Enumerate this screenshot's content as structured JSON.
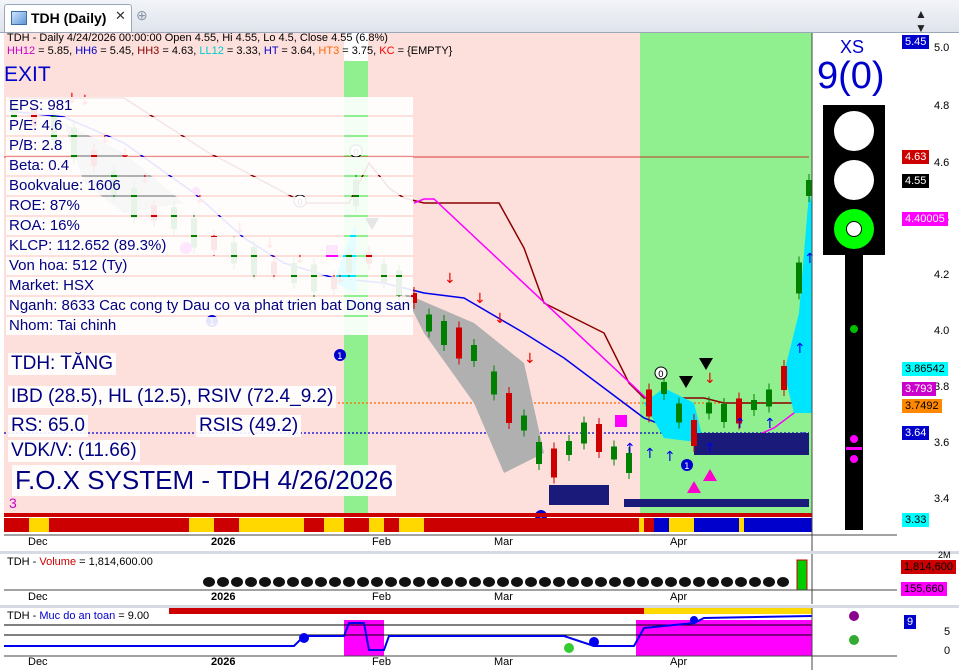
{
  "tab": {
    "title": "TDH (Daily)",
    "close": "✕",
    "add": "⊕"
  },
  "window_controls": "▲ ▼ ▲",
  "main": {
    "info_line1": "TDH - Daily 4/24/2026 00:00:00 Open 4.55, Hi 4.55, Lo 4.5, Close 4.55 (6.8%)",
    "info_line2": [
      {
        "text": "HH12",
        "color": "#cc00cc"
      },
      {
        "text": " = 5.85, ",
        "color": "#000"
      },
      {
        "text": "HH6",
        "color": "#0000cc"
      },
      {
        "text": " = 5.45, ",
        "color": "#000"
      },
      {
        "text": "HH3",
        "color": "#8b0000"
      },
      {
        "text": " = 4.63, ",
        "color": "#000"
      },
      {
        "text": "LL12",
        "color": "#00cccc"
      },
      {
        "text": " = 3.33, ",
        "color": "#000"
      },
      {
        "text": "HT",
        "color": "#0000cc"
      },
      {
        "text": "  = 3.64, ",
        "color": "#000"
      },
      {
        "text": "HT3",
        "color": "#ff6600"
      },
      {
        "text": " = 3.75, ",
        "color": "#000"
      },
      {
        "text": "KC",
        "color": "#ff0000"
      },
      {
        "text": " = {EMPTY}",
        "color": "#000"
      }
    ],
    "exit_label": "EXIT",
    "fundamentals": [
      "EPS: 981",
      "P/E: 4.6",
      "P/B: 2.8",
      "Beta: 0.4",
      "Bookvalue: 1606",
      "ROE: 87%",
      "ROA: 16%",
      "KLCP: 112.652 (89.3%)",
      "Von hoa: 512 (Ty)",
      "Market: HSX",
      "Nganh: 8633 Cac cong ty Dau co va phat trien bat Dong san",
      "Nhom: Tai chinh"
    ],
    "signal_title": "TDH: TĂNG",
    "ibd_line": "IBD (28.5), HL (12.5), RSIV (72.4_9.2)",
    "rs_line": "RS: 65.0",
    "rsis_line": "RSIS (49.2)",
    "vdk_line": "VDK/V:  (11.66)",
    "fox_line": "F.O.X SYSTEM - TDH 4/26/2026",
    "bottom_num": "3",
    "xs_label": "XS",
    "xs_value": "9(0)",
    "y_ticks": [
      "5.0",
      "4.8",
      "4.6",
      "4.4",
      "4.2",
      "4.0",
      "3.8",
      "3.6",
      "3.4"
    ],
    "x_labels": [
      "Dec",
      "2026",
      "Feb",
      "Mar",
      "Apr"
    ],
    "price_labels": [
      {
        "text": "5.45",
        "bg": "#0000cc",
        "fg": "#fff"
      },
      {
        "text": "4.63",
        "bg": "#cc0000",
        "fg": "#fff"
      },
      {
        "text": "4.55",
        "bg": "#000",
        "fg": "#fff"
      },
      {
        "text": "4.40005",
        "bg": "#ff00ff",
        "fg": "#fff"
      },
      {
        "text": "3.86542",
        "bg": "#00ffff",
        "fg": "#000"
      },
      {
        "text": "3.793",
        "bg": "#cc00cc",
        "fg": "#fff"
      },
      {
        "text": "3.7492",
        "bg": "#ff8800",
        "fg": "#000"
      },
      {
        "text": "3.64",
        "bg": "#0000cc",
        "fg": "#fff"
      },
      {
        "text": "3.33",
        "bg": "#00ffff",
        "fg": "#000"
      }
    ]
  },
  "volume_panel": {
    "title_prefix": "TDH - ",
    "title_name": "Volume",
    "title_suffix": " = 1,814,600.00",
    "scale_label": "2M",
    "value_labels": [
      {
        "text": "1,814,600",
        "bg": "#cc0000",
        "fg": "#000"
      },
      {
        "text": "155,660",
        "bg": "#ff00ff",
        "fg": "#000"
      }
    ],
    "x_labels": [
      "Dec",
      "2026",
      "Feb",
      "Mar",
      "Apr"
    ]
  },
  "safety_panel": {
    "title_prefix": "TDH - ",
    "title_name": "Muc do an toan",
    "title_suffix": " = 9.00",
    "y_ticks": [
      "5",
      "0"
    ],
    "value_label": {
      "text": "9",
      "bg": "#0000cc",
      "fg": "#fff"
    },
    "x_labels": [
      "Dec",
      "2026",
      "Feb",
      "Mar",
      "Apr"
    ]
  },
  "colors": {
    "up": "#008000",
    "down": "#cc0000",
    "zone_pink": "#fde0dc",
    "zone_green": "#90f090"
  }
}
